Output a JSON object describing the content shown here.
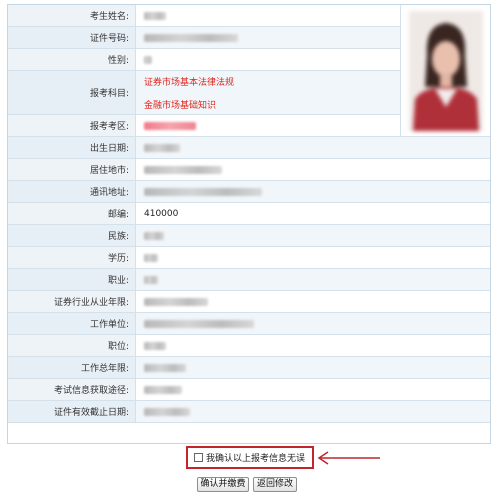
{
  "form": {
    "rows": [
      {
        "label": "考生姓名:",
        "value": ""
      },
      {
        "label": "证件号码:",
        "value": ""
      },
      {
        "label": "性别:",
        "value": ""
      },
      {
        "label": "报考科目:",
        "values": [
          "证券市场基本法律法规",
          "金融市场基础知识"
        ]
      },
      {
        "label": "报考考区:",
        "value": ""
      },
      {
        "label": "出生日期:",
        "value": ""
      },
      {
        "label": "居住地市:",
        "value": ""
      },
      {
        "label": "通讯地址:",
        "value": ""
      },
      {
        "label": "邮编:",
        "value": "410000"
      },
      {
        "label": "民族:",
        "value": ""
      },
      {
        "label": "学历:",
        "value": ""
      },
      {
        "label": "职业:",
        "value": ""
      },
      {
        "label": "证券行业从业年限:",
        "value": ""
      },
      {
        "label": "工作单位:",
        "value": ""
      },
      {
        "label": "职位:",
        "value": ""
      },
      {
        "label": "工作总年限:",
        "value": ""
      },
      {
        "label": "考试信息获取途径:",
        "value": ""
      },
      {
        "label": "证件有效截止日期:",
        "value": ""
      }
    ]
  },
  "confirm": {
    "label": "我确认以上报考信息无误"
  },
  "buttons": {
    "confirm_pay": "确认并缴费",
    "return_edit": "返回修改"
  },
  "colors": {
    "subject_text": "#e0261e",
    "highlight_border": "#c0262c",
    "label_bg": "#eef3f8"
  }
}
